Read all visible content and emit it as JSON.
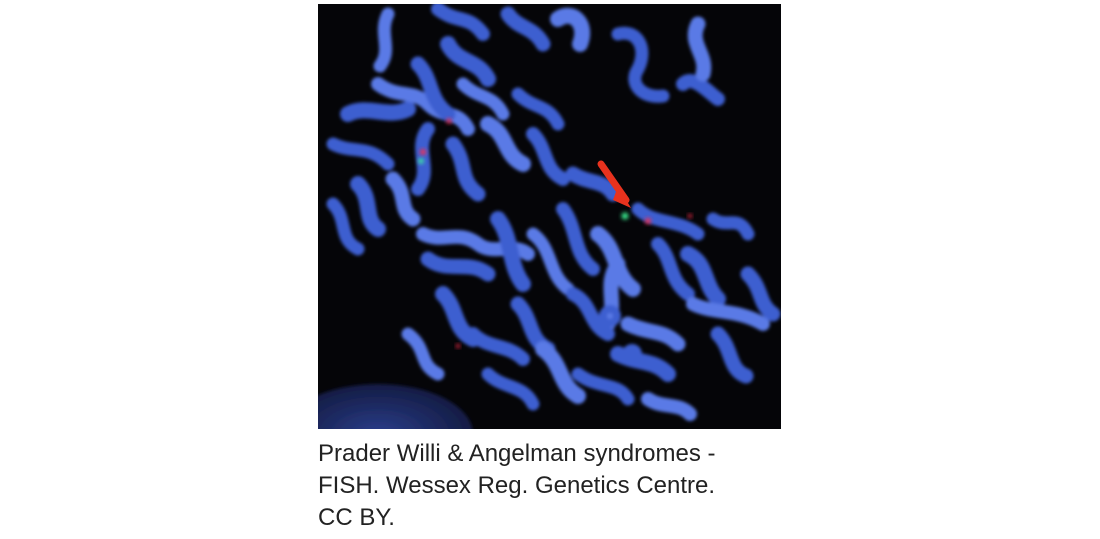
{
  "figure": {
    "subject": "FISH metaphase chromosome spread",
    "colors": {
      "background": "#050508",
      "chromosome": "#3c5fd0",
      "chromosome_highlight": "#5a7ae6",
      "probe_red": "#ff2a4a",
      "probe_green": "#3dff9a",
      "arrow": "#e8321e"
    },
    "icons": [
      "arrow-pointer-icon"
    ]
  },
  "caption": {
    "line1": "Prader Willi & Angelman syndromes -",
    "line2": "FISH. Wessex Reg. Genetics Centre.",
    "line3": "CC BY."
  }
}
